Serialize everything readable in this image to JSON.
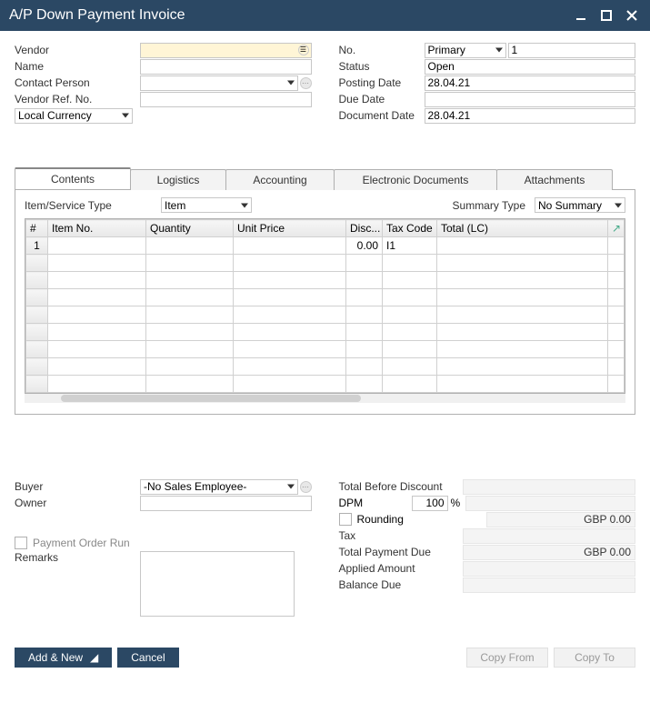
{
  "title": "A/P Down Payment Invoice",
  "left": {
    "vendor_lbl": "Vendor",
    "vendor_val": "",
    "name_lbl": "Name",
    "name_val": "",
    "contact_lbl": "Contact Person",
    "contact_val": "",
    "vendorref_lbl": "Vendor Ref. No.",
    "vendorref_val": "",
    "currency_val": "Local Currency"
  },
  "right": {
    "no_lbl": "No.",
    "no_series": "Primary",
    "no_val": "1",
    "status_lbl": "Status",
    "status_val": "Open",
    "posting_lbl": "Posting Date",
    "posting_val": "28.04.21",
    "due_lbl": "Due Date",
    "due_val": "",
    "doc_lbl": "Document Date",
    "doc_val": "28.04.21"
  },
  "tabs": [
    "Contents",
    "Logistics",
    "Accounting",
    "Electronic Documents",
    "Attachments"
  ],
  "tabtop": {
    "itemservice_lbl": "Item/Service Type",
    "itemservice_val": "Item",
    "summary_lbl": "Summary Type",
    "summary_val": "No Summary"
  },
  "gridhead": [
    "#",
    "Item No.",
    "Quantity",
    "Unit Price",
    "Disc...",
    "Tax Code",
    "Total (LC)"
  ],
  "rows": [
    {
      "num": "1",
      "item": "",
      "qty": "",
      "price": "",
      "disc": "0.00",
      "tax": "I1",
      "total": ""
    }
  ],
  "footleft": {
    "buyer_lbl": "Buyer",
    "buyer_val": "-No Sales Employee-",
    "owner_lbl": "Owner",
    "owner_val": "",
    "paymentorder_lbl": "Payment Order Run",
    "remarks_lbl": "Remarks"
  },
  "footright": {
    "tbd_lbl": "Total Before Discount",
    "tbd_val": "",
    "dpm_lbl": "DPM",
    "dpm_val": "100",
    "rounding_lbl": "Rounding",
    "rounding_val": "GBP 0.00",
    "tax_lbl": "Tax",
    "tax_val": "",
    "total_lbl": "Total Payment Due",
    "total_val": "GBP 0.00",
    "applied_lbl": "Applied Amount",
    "applied_val": "",
    "balance_lbl": "Balance Due",
    "balance_val": ""
  },
  "buttons": {
    "addnew": "Add & New",
    "cancel": "Cancel",
    "copyfrom": "Copy From",
    "copyto": "Copy To"
  }
}
